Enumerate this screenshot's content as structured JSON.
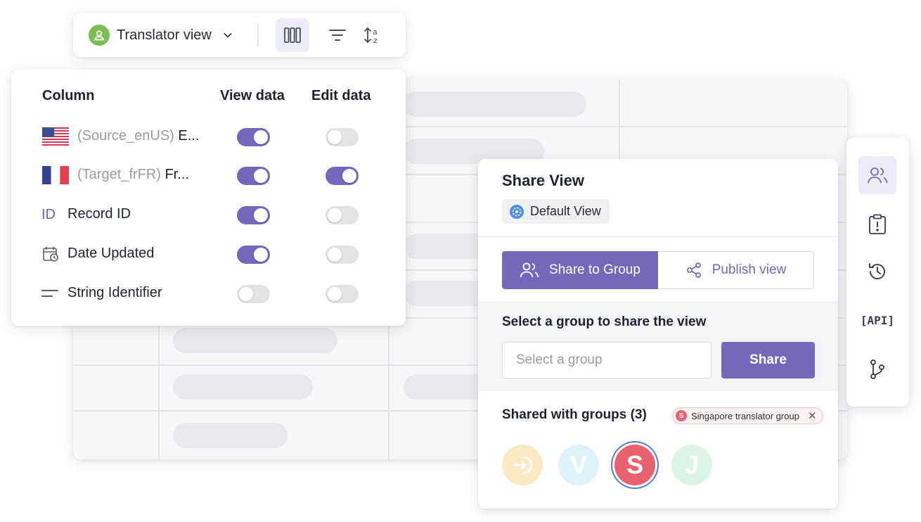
{
  "toolbar": {
    "view_name": "Translator view",
    "icons": [
      "user-icon",
      "chevron-down-icon",
      "columns-icon",
      "filter-icon",
      "sort-az-icon"
    ]
  },
  "columns_panel": {
    "headers": {
      "column": "Column",
      "view_data": "View data",
      "edit_data": "Edit data"
    },
    "rows": [
      {
        "icon": "us-flag-icon",
        "muted": "(Source_enUS)",
        "label": "E...",
        "view": true,
        "edit": false
      },
      {
        "icon": "fr-flag-icon",
        "muted": "(Target_frFR)",
        "label": "Fr...",
        "view": true,
        "edit": true
      },
      {
        "icon": "id-icon",
        "icon_text": "ID",
        "muted": "",
        "label": "Record ID",
        "view": true,
        "edit": false
      },
      {
        "icon": "calendar-clock-icon",
        "muted": "",
        "label": "Date Updated",
        "view": true,
        "edit": false
      },
      {
        "icon": "text-lines-icon",
        "muted": "",
        "label": "String Identifier",
        "view": false,
        "edit": false
      }
    ]
  },
  "share_view": {
    "title": "Share View",
    "default_view": "Default View",
    "tabs": {
      "share_to_group": "Share to Group",
      "publish_view": "Publish view"
    },
    "select_label": "Select a group to share the view",
    "select_placeholder": "Select a group",
    "share_button": "Share",
    "shared_with": "Shared with groups (3)",
    "tag": {
      "initial": "S",
      "label": "Singapore translator group",
      "close": "✕"
    },
    "avatars": [
      {
        "initial": "",
        "icon": "key-login-icon",
        "color": "#fbe9c4",
        "selected": false
      },
      {
        "initial": "V",
        "color": "#dff2fa",
        "selected": false
      },
      {
        "initial": "S",
        "color": "#e8636f",
        "selected": true
      },
      {
        "initial": "J",
        "color": "#dcf3e6",
        "selected": false
      }
    ]
  },
  "right_rail": {
    "api_label": "[API]",
    "items": [
      "users-icon",
      "alert-clipboard-icon",
      "history-icon",
      "api-icon",
      "branch-icon"
    ]
  },
  "colors": {
    "accent": "#7468bb",
    "toggle_off": "#e3e3e6",
    "green_badge": "#7bbf54",
    "red_avatar": "#e8636f"
  }
}
